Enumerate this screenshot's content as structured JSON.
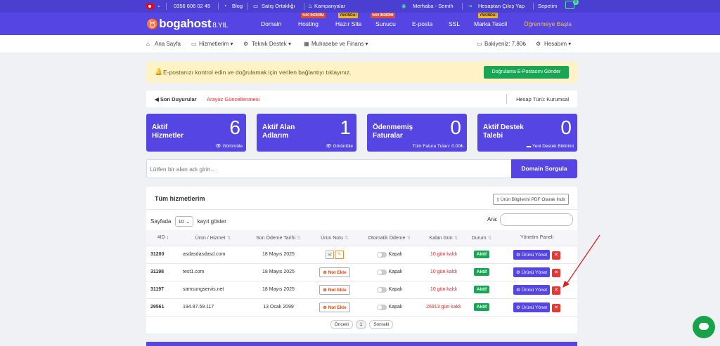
{
  "topbar": {
    "flag": "turkey-flag",
    "phone": "0356 606 02 45",
    "blog": "Blog",
    "satis": "Satış Ortaklığı",
    "kampanya": "Kampanyalar",
    "greeting": "Merhaba - Semih",
    "logout": "Hesaptan Çıkış Yap",
    "cart": "Sepetim",
    "cart_count": "0"
  },
  "brand": {
    "name": "bogahost",
    "years": "8.YIL"
  },
  "mainnav": {
    "items": [
      {
        "label": "Domain",
        "badge": ""
      },
      {
        "label": "Hosting",
        "badge": "%50 İNDİRİM"
      },
      {
        "label": "Hazır Site",
        "badge": "YAKINDA!"
      },
      {
        "label": "Sunucu",
        "badge": "%50 İNDİRİM"
      },
      {
        "label": "E-posta",
        "badge": ""
      },
      {
        "label": "SSL",
        "badge": ""
      },
      {
        "label": "Marka Tescil",
        "badge": "YAKINDA!"
      },
      {
        "label": "Öğrenmeye Başla",
        "badge": ""
      }
    ]
  },
  "subnav": {
    "home": "Ana Sayfa",
    "services": "Hizmetlerim",
    "support": "Teknik Destek",
    "finance": "Muhasebe ve Finans",
    "balance": "Bakiyeniz: 7.80₺",
    "account": "Hesabım"
  },
  "alert": {
    "text": "E-postanızı kontrol edin ve doğrulamak için verilen bağlantıyı tıklayınız.",
    "button": "Doğrulama E-Postasını Gönder"
  },
  "announce": {
    "label": "Son Duyurular",
    "link": "Arayüz Güncellenmesi",
    "account_type": "Hesap Türü: Kurumsal"
  },
  "cards": [
    {
      "title": "Aktif Hizmetler",
      "num": "6",
      "foot": "Görüntüle"
    },
    {
      "title": "Aktif Alan Adlarım",
      "num": "1",
      "foot": "Görüntüle"
    },
    {
      "title": "Ödenmemiş Faturalar",
      "num": "0",
      "foot": "Tüm Fatura Tutarı: 0.00₺"
    },
    {
      "title": "Aktif Destek Talebi",
      "num": "0",
      "foot": "Yeni Destek Bildirimi"
    }
  ],
  "domain_search": {
    "placeholder": "Lütfen bir alan adı girin...",
    "button": "Domain Sorgula"
  },
  "services": {
    "title": "Tüm hizmetlerim",
    "pdf_button": "Ürün Bilgilerini PDF Olarak İndir",
    "show_prefix": "Sayfada",
    "page_size": "10",
    "show_suffix": "kayıt göster",
    "search_label": "Ara:",
    "headers": [
      "#ID",
      "Ürün / Hizmet",
      "Son Ödeme Tarihi",
      "Ürün Notu",
      "Otomatik Ödeme",
      "Kalan Gün",
      "Durum",
      "Yönetim Paneli"
    ],
    "rows": [
      {
        "id": "31200",
        "product": "asdasdasdasd.com",
        "due": "18 Mayıs 2025",
        "note": "sz",
        "auto": "Kapalı",
        "left": "10 gün kaldı",
        "status": "Aktif",
        "manage": "Ürünü Yönet"
      },
      {
        "id": "31198",
        "product": "test1.com",
        "due": "18 Mayıs 2025",
        "note": "Not Ekle",
        "auto": "Kapalı",
        "left": "10 gün kaldı",
        "status": "Aktif",
        "manage": "Ürünü Yönet"
      },
      {
        "id": "31197",
        "product": "samsungservis.net",
        "due": "18 Mayıs 2025",
        "note": "Not Ekle",
        "auto": "Kapalı",
        "left": "10 gün kaldı",
        "status": "Aktif",
        "manage": "Ürünü Yönet"
      },
      {
        "id": "29561",
        "product": "194.87.59.117",
        "due": "13 Ocak 2099",
        "note": "Not Ekle",
        "auto": "Kapalı",
        "left": "26913 gün kaldı",
        "status": "Aktif",
        "manage": "Ürünü Yönet"
      }
    ],
    "pager": {
      "prev": "Önceki",
      "current": "1",
      "next": "Sonraki"
    }
  },
  "colors": {
    "primary": "#5546e4",
    "topbar": "#4a3fd0",
    "success": "#1aa554",
    "danger": "#e53935",
    "alert_bg": "#fdf3c7"
  }
}
